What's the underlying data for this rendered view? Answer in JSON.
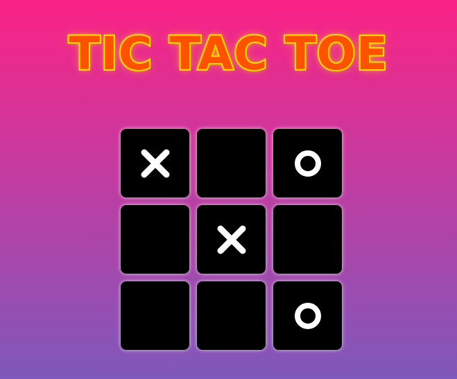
{
  "title": "TIC TAC TOE",
  "colors": {
    "background_top": "#fb2285",
    "background_bottom": "#7e58ba",
    "title_fill": "#ff5200",
    "title_stroke": "#ffe800",
    "cell": "#000000",
    "mark": "#ffffff"
  },
  "board": {
    "cells": [
      "X",
      "",
      "O",
      "",
      "X",
      "",
      "",
      "",
      "O"
    ]
  }
}
